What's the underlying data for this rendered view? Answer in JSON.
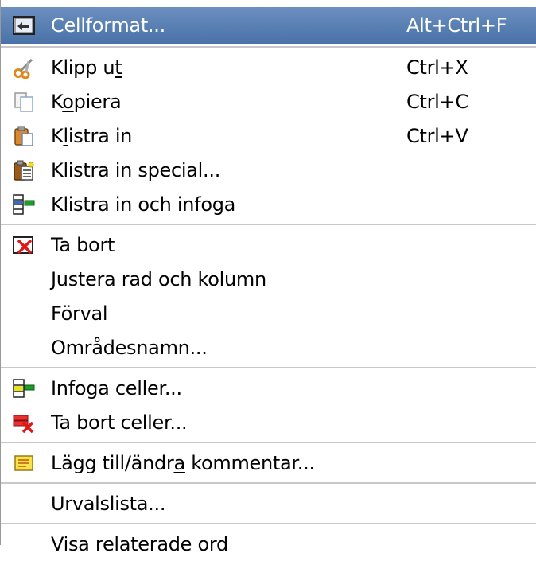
{
  "menu": {
    "items": [
      {
        "key": "cellformat",
        "label": "Cellformat...",
        "shortcut": "Alt+Ctrl+F",
        "icon": "cell-format-icon",
        "highlighted": true
      },
      {
        "key": "klipp_ut",
        "label_pre": "Klipp u",
        "label_mn": "t",
        "label_post": "",
        "shortcut": "Ctrl+X",
        "icon": "scissors-icon"
      },
      {
        "key": "kopiera",
        "label_pre": "K",
        "label_mn": "o",
        "label_post": "piera",
        "shortcut": "Ctrl+C",
        "icon": "copy-icon"
      },
      {
        "key": "klistra_in",
        "label_pre": "K",
        "label_mn": "l",
        "label_post": "istra in",
        "shortcut": "Ctrl+V",
        "icon": "paste-icon"
      },
      {
        "key": "klistra_in_special",
        "label": "Klistra in special...",
        "icon": "paste-special-icon"
      },
      {
        "key": "klistra_in_infoga",
        "label": "Klistra in och infoga",
        "icon": "paste-insert-icon"
      },
      {
        "key": "ta_bort",
        "label": "Ta bort",
        "icon": "delete-icon"
      },
      {
        "key": "justera",
        "label": "Justera rad och kolumn"
      },
      {
        "key": "forval",
        "label": "Förval"
      },
      {
        "key": "omradesnamn",
        "label": "Områdesnamn..."
      },
      {
        "key": "infoga_celler",
        "label": "Infoga celler...",
        "icon": "insert-cells-icon"
      },
      {
        "key": "ta_bort_celler",
        "label": "Ta bort celler...",
        "icon": "delete-cells-icon"
      },
      {
        "key": "kommentar",
        "label_pre": "Lägg till/ändr",
        "label_mn": "a",
        "label_post": " kommentar...",
        "icon": "comment-icon"
      },
      {
        "key": "urvalslista",
        "label": "Urvalslista..."
      },
      {
        "key": "relaterade",
        "label": "Visa relaterade ord"
      }
    ]
  },
  "colors": {
    "highlight": "#5a80b4",
    "separator": "#c8c8c8"
  }
}
